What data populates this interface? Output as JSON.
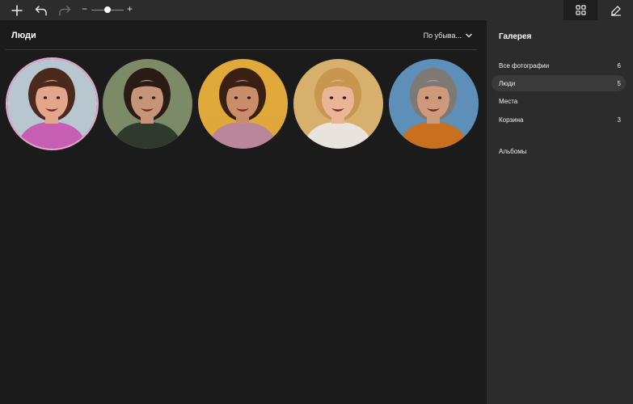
{
  "toolbar": {
    "zoom_minus": "−",
    "zoom_plus": "+",
    "zoom_level": 0.5
  },
  "main": {
    "title": "Люди",
    "sort_label": "По убыва..."
  },
  "people": [
    {
      "bg": "#b7c6cf",
      "skin": "#e3a58c",
      "hair": "#4a2a1c",
      "shirt": "#c65fb4",
      "selected": true
    },
    {
      "bg": "#7d8a68",
      "skin": "#c59479",
      "hair": "#2a1b14",
      "shirt": "#2f3a2c",
      "selected": false
    },
    {
      "bg": "#e0a93a",
      "skin": "#c98d6b",
      "hair": "#3a1f14",
      "shirt": "#b9869b",
      "selected": false
    },
    {
      "bg": "#d6b06c",
      "skin": "#e9b596",
      "hair": "#c8964f",
      "shirt": "#e8e3dc",
      "selected": false
    },
    {
      "bg": "#5d8fb8",
      "skin": "#cf9a7c",
      "hair": "#7d7a76",
      "shirt": "#c9701f",
      "selected": false
    }
  ],
  "sidebar": {
    "title": "Галерея",
    "items": [
      {
        "label": "Все фотографии",
        "count": "6",
        "active": false
      },
      {
        "label": "Люди",
        "count": "5",
        "active": true
      },
      {
        "label": "Места",
        "count": "",
        "active": false
      },
      {
        "label": "Корзина",
        "count": "3",
        "active": false
      }
    ],
    "albums_label": "Альбомы"
  },
  "colors": {
    "background": "#1c1b1c",
    "panel": "#2d2c2d",
    "active_item": "#3b3a3b",
    "selection_ring": "#e9a6c9"
  }
}
